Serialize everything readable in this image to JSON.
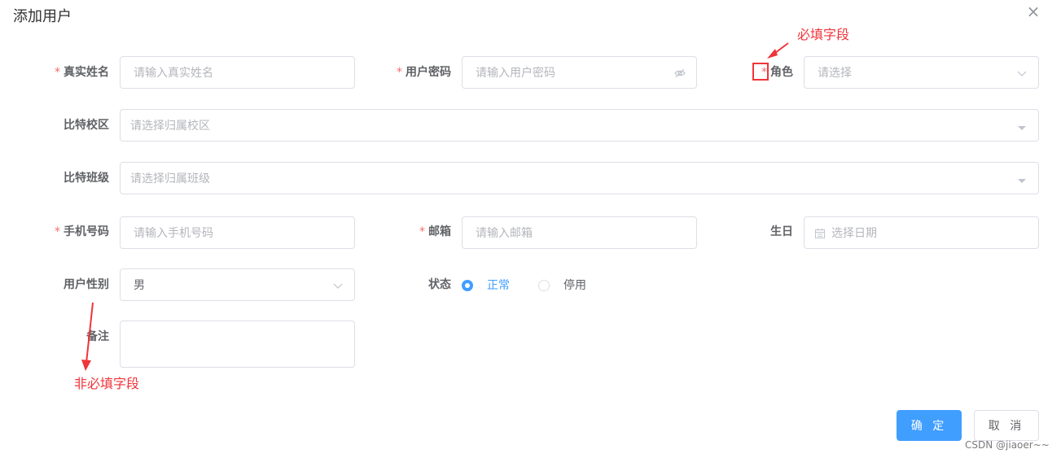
{
  "dialog": {
    "title": "添加用户",
    "close_icon": "×"
  },
  "required_mark": "*",
  "fields": {
    "real_name": {
      "label": "真实姓名",
      "placeholder": "请输入真实姓名"
    },
    "password": {
      "label": "用户密码",
      "placeholder": "请输入用户密码"
    },
    "role": {
      "label": "角色",
      "placeholder": "请选择"
    },
    "campus": {
      "label": "比特校区",
      "placeholder": "请选择归属校区"
    },
    "class": {
      "label": "比特班级",
      "placeholder": "请选择归属班级"
    },
    "phone": {
      "label": "手机号码",
      "placeholder": "请输入手机号码"
    },
    "email": {
      "label": "邮箱",
      "placeholder": "请输入邮箱"
    },
    "birthday": {
      "label": "生日",
      "placeholder": "选择日期"
    },
    "gender": {
      "label": "用户性别",
      "value": "男"
    },
    "status": {
      "label": "状态",
      "options": [
        "正常",
        "停用"
      ],
      "selected": "正常"
    },
    "remark": {
      "label": "备注",
      "value": ""
    }
  },
  "buttons": {
    "confirm": "确 定",
    "cancel": "取 消"
  },
  "annotations": {
    "required": "必填字段",
    "optional": "非必填字段"
  },
  "watermark": "CSDN @jiaoer~~",
  "colors": {
    "primary": "#409eff",
    "required": "#f56c6c",
    "annotation": "#f0343a"
  }
}
